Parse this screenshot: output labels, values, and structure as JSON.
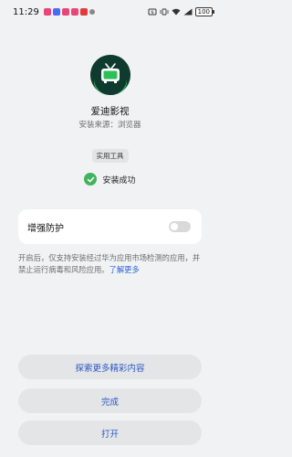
{
  "status_bar": {
    "time": "11:29",
    "battery": "100",
    "notification_icons": [
      {
        "name": "app-notification-icon-1",
        "color": "#e8457a"
      },
      {
        "name": "app-notification-icon-2",
        "color": "#4a6cf0"
      },
      {
        "name": "app-notification-icon-3",
        "color": "#e8457a"
      },
      {
        "name": "app-notification-icon-4",
        "color": "#e8457a"
      },
      {
        "name": "app-notification-icon-5",
        "color": "#e03a3a"
      }
    ]
  },
  "app": {
    "name": "爱迪影视",
    "source": "安装来源：浏览器",
    "category_tag": "实用工具",
    "icon": "tv-icon",
    "icon_colors": {
      "background": "#0f3b2f",
      "accent": "#2fbf5a"
    }
  },
  "install": {
    "status": "安装成功",
    "status_color": "#42b35f"
  },
  "protection": {
    "title": "增强防护",
    "enabled": false,
    "description": "开启后，仅支持安装经过华为应用市场检测的应用，并禁止运行病毒和风险应用。",
    "learn_more": "了解更多"
  },
  "buttons": {
    "explore": "探索更多精彩内容",
    "done": "完成",
    "open": "打开"
  },
  "colors": {
    "accent": "#2a56c6",
    "link": "#2a64d6",
    "background": "#f1f2f4"
  }
}
